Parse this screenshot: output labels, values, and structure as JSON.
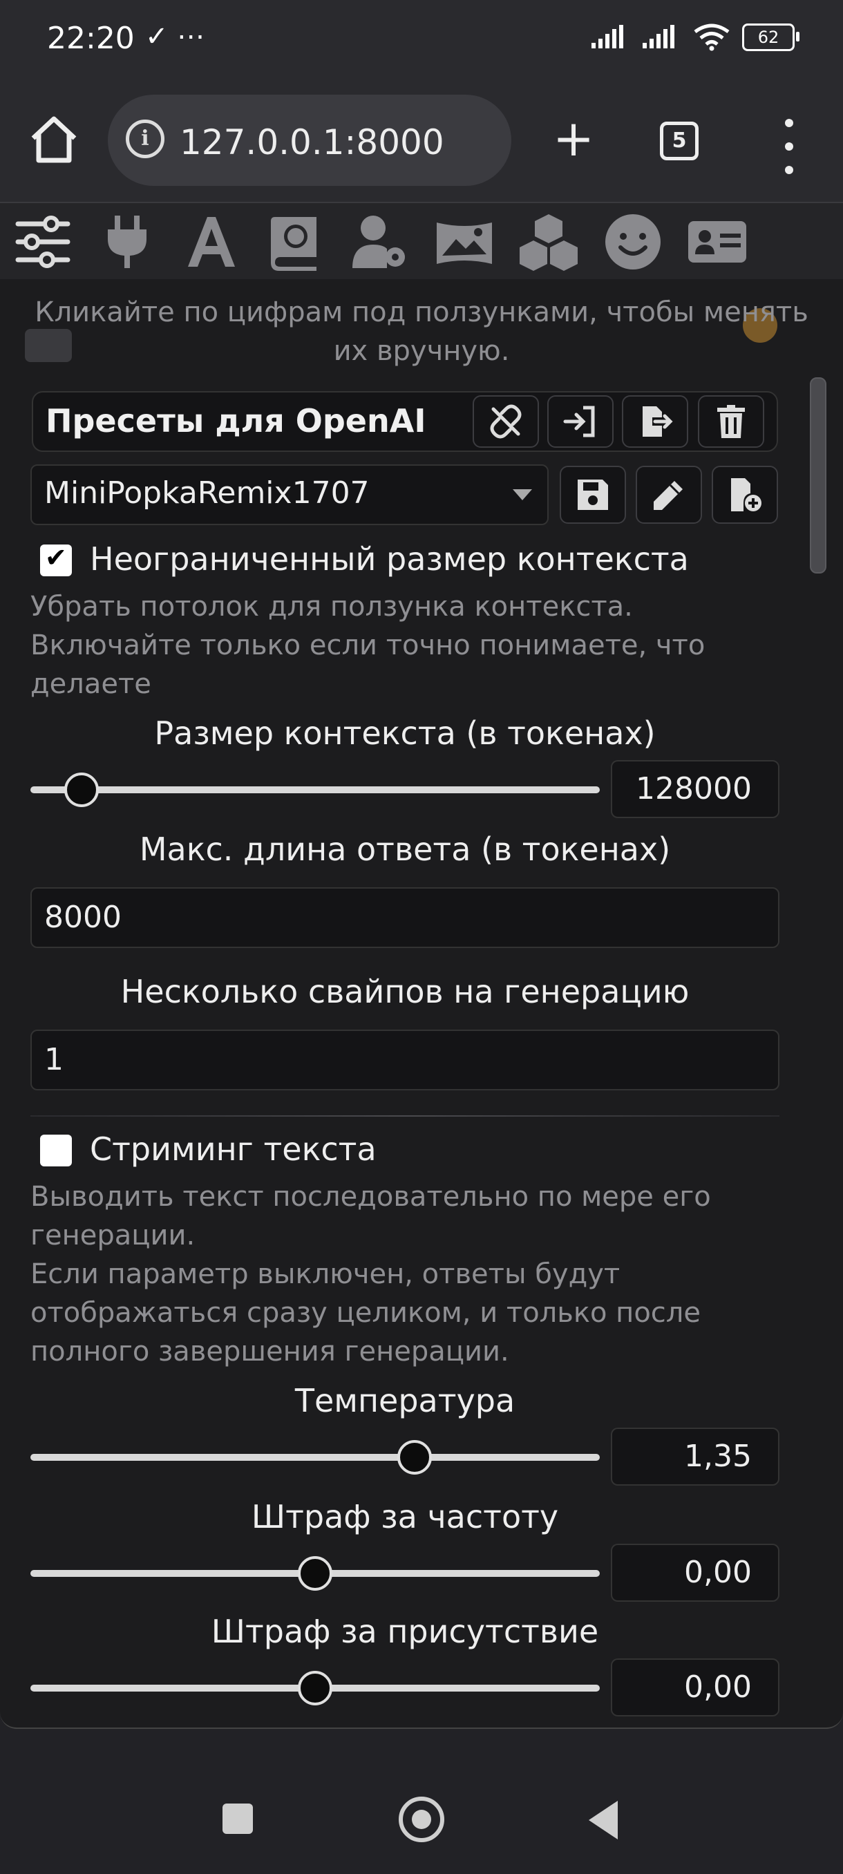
{
  "status_bar": {
    "time": "22:20",
    "left_icons": "✓ ⋯",
    "battery": "62"
  },
  "browser": {
    "url": "127.0.0.1:8000",
    "info_glyph": "i",
    "new_tab_glyph": "+",
    "tab_count": "5"
  },
  "top_nav": {
    "icons": [
      "sliders-icon",
      "plug-icon",
      "font-icon",
      "book-globe-icon",
      "user-gear-icon",
      "image-icon",
      "cubes-icon",
      "smile-icon",
      "id-card-icon"
    ]
  },
  "panel": {
    "hint": "Кликайте по цифрам под ползунками, чтобы менять их вручную.",
    "preset": {
      "title": "Пресеты для OpenAI",
      "selected": "MiniPopkaRemix1707"
    },
    "unlimited_context": {
      "label": "Неограниченный размер контекста",
      "checked": true,
      "description_line1": "Убрать потолок для ползунка контекста.",
      "description_line2": "Включайте только если точно понимаете, что делаете"
    },
    "context_size": {
      "label": "Размер контекста (в токенах)",
      "value": "128000",
      "slider_fraction": 0.09
    },
    "max_response": {
      "label": "Макс. длина ответа (в токенах)",
      "value": "8000"
    },
    "swipes": {
      "label": "Несколько свайпов на генерацию",
      "value": "1"
    },
    "streaming": {
      "label": "Стриминг текста",
      "checked": false,
      "description_line1": "Выводить текст последовательно по мере его генерации.",
      "description_line2": "Если параметр выключен, ответы будут отображаться сразу целиком, и только после полного завершения генерации."
    },
    "temperature": {
      "label": "Температура",
      "value": "1,35",
      "slider_fraction": 0.675
    },
    "frequency_penalty": {
      "label": "Штраф за частоту",
      "value": "0,00",
      "slider_fraction": 0.5
    },
    "presence_penalty": {
      "label": "Штраф за присутствие",
      "value": "0,00",
      "slider_fraction": 0.5
    }
  },
  "colors": {
    "background": "#222226",
    "panel": "#1c1c1e",
    "text": "#e6e6e6",
    "muted": "#8f8f93"
  }
}
